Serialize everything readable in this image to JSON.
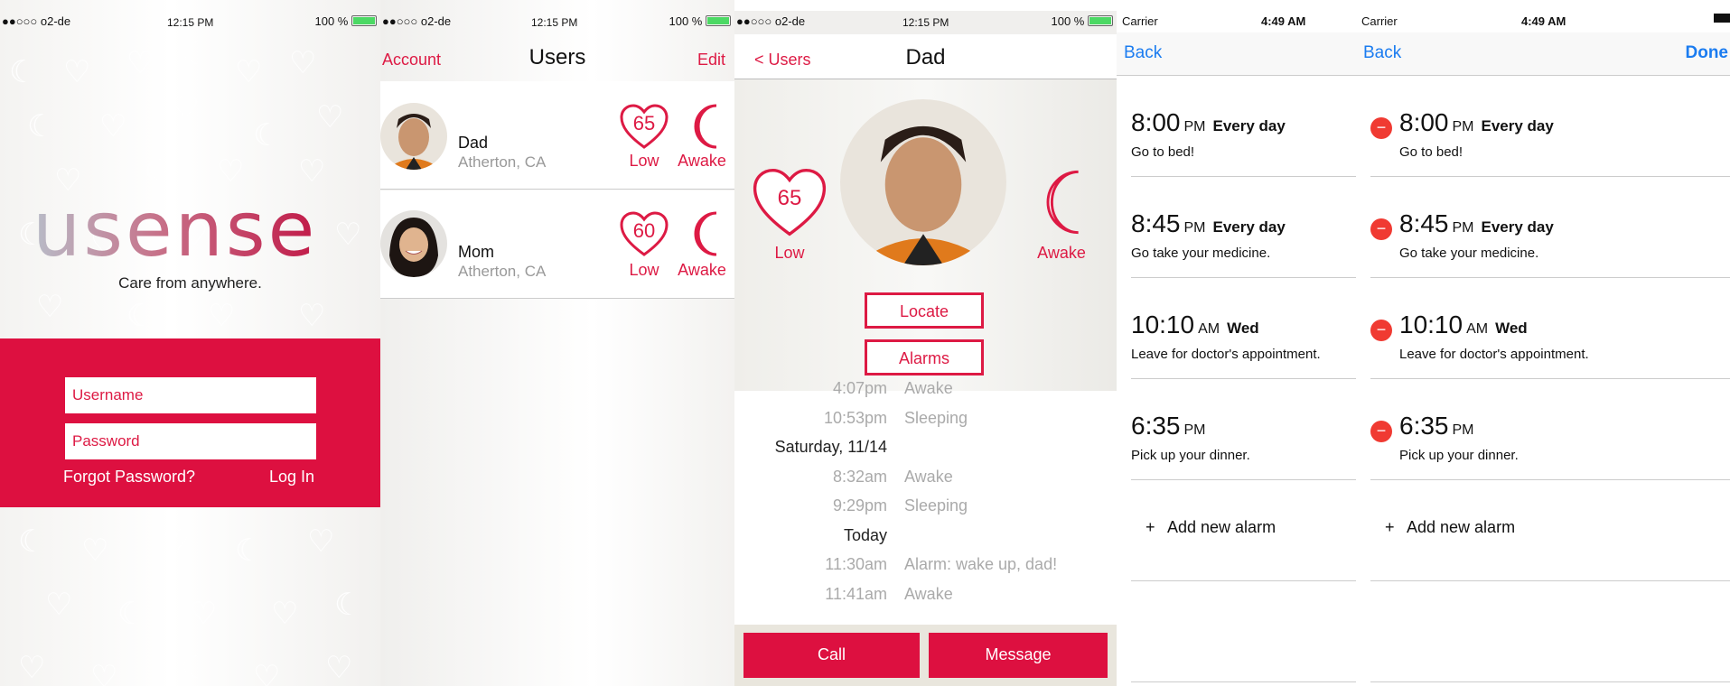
{
  "statusbar_o2": {
    "carrier": "●●○○○ o2-de",
    "time": "12:15 PM",
    "battery": "100 %"
  },
  "statusbar_carrier": {
    "carrier": "Carrier",
    "time": "4:49 AM"
  },
  "login_screen": {
    "logo": "usense",
    "tagline": "Care from anywhere.",
    "username_placeholder": "Username",
    "password_placeholder": "Password",
    "forgot_password": "Forgot Password?",
    "login": "Log In"
  },
  "users_screen": {
    "left_button": "Account",
    "title": "Users",
    "right_button": "Edit",
    "users": [
      {
        "name": "Dad",
        "location": "Atherton, CA",
        "heart_rate": "65",
        "hr_label": "Low",
        "state": "Awake"
      },
      {
        "name": "Mom",
        "location": "Atherton, CA",
        "heart_rate": "60",
        "hr_label": "Low",
        "state": "Awake"
      }
    ]
  },
  "detail_screen": {
    "back": "< Users",
    "title": "Dad",
    "heart_rate": "65",
    "hr_label": "Low",
    "state": "Awake",
    "locate": "Locate",
    "alarms": "Alarms",
    "history": [
      {
        "time": "4:07pm",
        "event": "Awake"
      },
      {
        "time": "10:53pm",
        "event": "Sleeping"
      },
      {
        "day": "Saturday, 11/14"
      },
      {
        "time": "8:32am",
        "event": "Awake"
      },
      {
        "time": "9:29pm",
        "event": "Sleeping"
      },
      {
        "day": "Today"
      },
      {
        "time": "11:30am",
        "event": "Alarm: wake up, dad!"
      },
      {
        "time": "11:41am",
        "event": "Awake"
      }
    ],
    "call": "Call",
    "message": "Message"
  },
  "alarms_screen": {
    "back": "Back",
    "done": "Done",
    "alarms": [
      {
        "time": "8:00",
        "ampm": "PM",
        "repeat": "Every day",
        "label": "Go to bed!"
      },
      {
        "time": "8:45",
        "ampm": "PM",
        "repeat": "Every day",
        "label": "Go take your medicine."
      },
      {
        "time": "10:10",
        "ampm": "AM",
        "repeat": "Wed",
        "label": "Leave for doctor's appointment."
      },
      {
        "time": "6:35",
        "ampm": "PM",
        "repeat": "",
        "label": "Pick up your dinner."
      }
    ],
    "add_new": "Add new alarm",
    "plus": "+",
    "minus": "−"
  },
  "colors": {
    "accent": "#dd1a44",
    "ios_blue": "#1b7cf0",
    "delete_red": "#f03a32"
  }
}
